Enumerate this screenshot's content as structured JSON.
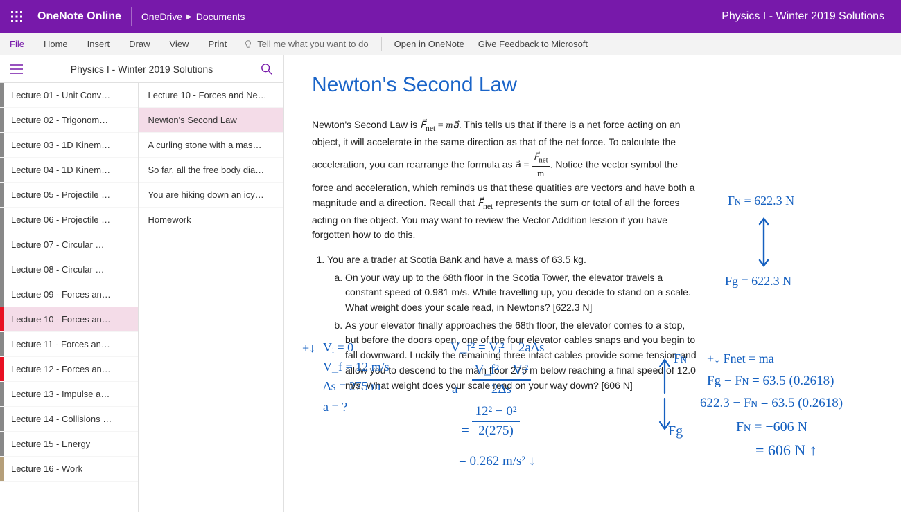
{
  "titlebar": {
    "app_name": "OneNote Online",
    "breadcrumb_root": "OneDrive",
    "breadcrumb_folder": "Documents",
    "doc_title": "Physics I - Winter 2019 Solutions"
  },
  "ribbon": {
    "file": "File",
    "home": "Home",
    "insert": "Insert",
    "draw": "Draw",
    "view": "View",
    "print": "Print",
    "tellme_placeholder": "Tell me what you want to do",
    "open_in_onenote": "Open in OneNote",
    "give_feedback": "Give Feedback to Microsoft"
  },
  "nav": {
    "notebook_title": "Physics I - Winter 2019 Solutions",
    "sections": [
      {
        "label": "Lecture 01 - Unit Conv…",
        "color": "gray"
      },
      {
        "label": "Lecture 02 - Trigonom…",
        "color": "gray"
      },
      {
        "label": "Lecture 03 - 1D Kinem…",
        "color": "gray"
      },
      {
        "label": "Lecture 04 - 1D Kinem…",
        "color": "gray"
      },
      {
        "label": "Lecture 05 - Projectile …",
        "color": "gray"
      },
      {
        "label": "Lecture 06 - Projectile …",
        "color": "gray"
      },
      {
        "label": "Lecture 07 - Circular …",
        "color": "gray"
      },
      {
        "label": "Lecture 08 - Circular …",
        "color": "gray"
      },
      {
        "label": "Lecture 09 - Forces an…",
        "color": "gray"
      },
      {
        "label": "Lecture 10 - Forces an…",
        "color": "red",
        "selected": true
      },
      {
        "label": "Lecture 11 - Forces an…",
        "color": "gray"
      },
      {
        "label": "Lecture 12 - Forces an…",
        "color": "red"
      },
      {
        "label": "Lecture 13 - Impulse a…",
        "color": "gray"
      },
      {
        "label": "Lecture 14 - Collisions …",
        "color": "gray"
      },
      {
        "label": "Lecture 15 - Energy",
        "color": "gray"
      },
      {
        "label": "Lecture 16 - Work",
        "color": "tan"
      }
    ],
    "pages": [
      {
        "label": "Lecture 10 - Forces and Ne…"
      },
      {
        "label": "Newton's Second Law",
        "selected": true
      },
      {
        "label": "A curling stone with a mas…"
      },
      {
        "label": "So far, all the free body dia…"
      },
      {
        "label": "You are hiking down an icy…"
      },
      {
        "label": "Homework"
      }
    ]
  },
  "page": {
    "title": "Newton's Second Law",
    "intro_prefix": "Newton's Second Law is ",
    "intro_mid": ". This tells us that if there is a net force acting on an object, it will accelerate in the same direction as that of the net force. To calculate the acceleration, you can rearrange the formula as ",
    "intro_suffix": ".  Notice the vector symbol the force and acceleration, which reminds us that these quatities are vectors and have both a magnitude and a direction. Recall that ",
    "intro_end": " represents the sum or total of all the forces acting on the object. You may want to review the Vector Addition lesson if you have forgotten how to do this.",
    "formula_lhs_html": "F⃗<sub>net</sub> = ma⃗",
    "formula_accel_lhs": "a⃗ = ",
    "formula_frac_num": "F⃗ₙₑₜ",
    "formula_frac_den": "m",
    "fnet_symbol": "F⃗ₙₑₜ",
    "problem1_stem": "You are a trader at Scotia Bank and have a mass of 63.5 kg.",
    "problem1a": "On your way up to the 68th floor in the Scotia Tower, the elevator travels a constant speed of 0.981 m/s. While travelling up, you decide to stand on a scale. What weight does your scale read, in Newtons? [622.3 N]",
    "problem1b": "As your elevator finally approaches the 68th floor, the elevator comes to a stop, but before the doors open, one of the four elevator cables snaps and you begin to fall downward. Luckily the remaining three intact cables provide some tension and allow you to descend to the main floor 275 m below reaching a final speed of 12.0 m/s. What weight does your scale read on your way down? [606 N]"
  },
  "ink": {
    "fn": "Fɴ = 622.3 N",
    "fg": "Fg = 622.3 N",
    "givens_title": "+↓",
    "g1": "Vᵢ = 0",
    "g2": "V_f = 12 m/s",
    "g3": "Δs = 275 m",
    "g4": "a = ?",
    "kin1": "V_f² = Vᵢ² + 2aΔs",
    "kin2_num": "V_f² − Vᵢ²",
    "kin2_den": "2Δs",
    "kin2_lhs": "a =",
    "kin3_num": "12² − 0²",
    "kin3_den": "2(275)",
    "kin3_lhs": "=",
    "kin4": "= 0.262 m/s² ↓",
    "fn_label": "Fɴ",
    "fg_label": "Fg",
    "r1": "+↓ Fnet = ma",
    "r2": "Fg − Fɴ = 63.5 (0.2618)",
    "r3": "622.3 − Fɴ = 63.5 (0.2618)",
    "r4": "Fɴ = −606 N",
    "r5": "= 606 N ↑"
  }
}
